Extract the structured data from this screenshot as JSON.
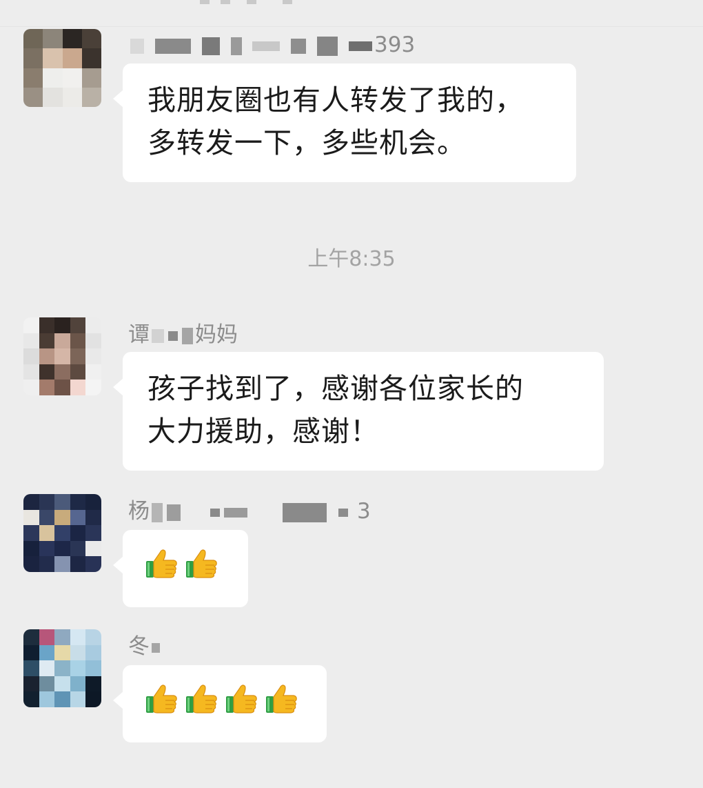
{
  "messages": [
    {
      "sender": "393",
      "lines": [
        "我朋友圈也有人转发了我的，",
        "多转发一下，多些机会。"
      ]
    },
    {
      "sender_prefix": "谭",
      "sender_suffix": "妈妈",
      "lines": [
        "孩子找到了，感谢各位家长的",
        "大力援助，感谢！"
      ]
    },
    {
      "sender_prefix": "杨",
      "sender_suffix": "3",
      "emoji": [
        "thumbs-up-icon",
        "thumbs-up-icon"
      ]
    },
    {
      "sender_prefix": "冬",
      "emoji": [
        "thumbs-up-icon",
        "thumbs-up-icon",
        "thumbs-up-icon",
        "thumbs-up-icon"
      ]
    }
  ],
  "timestamp": "上午8:35",
  "colors": {
    "background": "#ededed",
    "bubble": "#ffffff",
    "text": "#1b1b1b",
    "sender": "#8c8c8c",
    "timestamp": "#a3a3a3"
  }
}
